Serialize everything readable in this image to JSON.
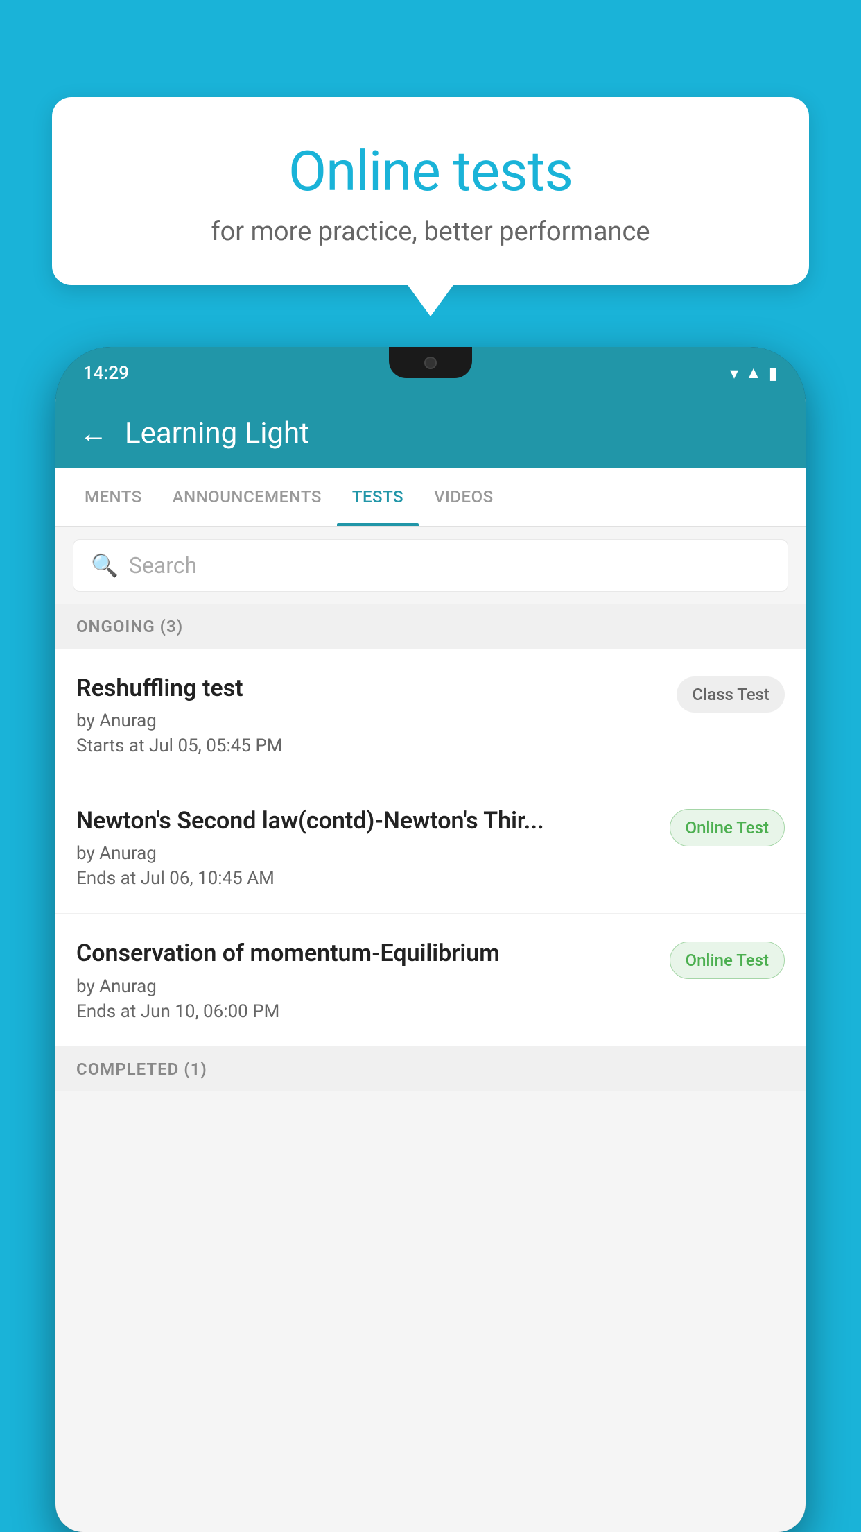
{
  "background": {
    "color": "#1ab3d8"
  },
  "speech_bubble": {
    "title": "Online tests",
    "subtitle": "for more practice, better performance"
  },
  "phone": {
    "status_bar": {
      "time": "14:29",
      "wifi": "▾",
      "signal": "▲",
      "battery": "▮"
    },
    "header": {
      "back_label": "←",
      "title": "Learning Light"
    },
    "tabs": [
      {
        "label": "MENTS",
        "active": false
      },
      {
        "label": "ANNOUNCEMENTS",
        "active": false
      },
      {
        "label": "TESTS",
        "active": true
      },
      {
        "label": "VIDEOS",
        "active": false
      }
    ],
    "search": {
      "placeholder": "Search"
    },
    "sections": [
      {
        "header": "ONGOING (3)",
        "items": [
          {
            "name": "Reshuffling test",
            "author": "by Anurag",
            "date": "Starts at  Jul 05, 05:45 PM",
            "badge": "Class Test",
            "badge_type": "class"
          },
          {
            "name": "Newton's Second law(contd)-Newton's Thir...",
            "author": "by Anurag",
            "date": "Ends at  Jul 06, 10:45 AM",
            "badge": "Online Test",
            "badge_type": "online"
          },
          {
            "name": "Conservation of momentum-Equilibrium",
            "author": "by Anurag",
            "date": "Ends at  Jun 10, 06:00 PM",
            "badge": "Online Test",
            "badge_type": "online"
          }
        ]
      },
      {
        "header": "COMPLETED (1)",
        "items": []
      }
    ]
  }
}
